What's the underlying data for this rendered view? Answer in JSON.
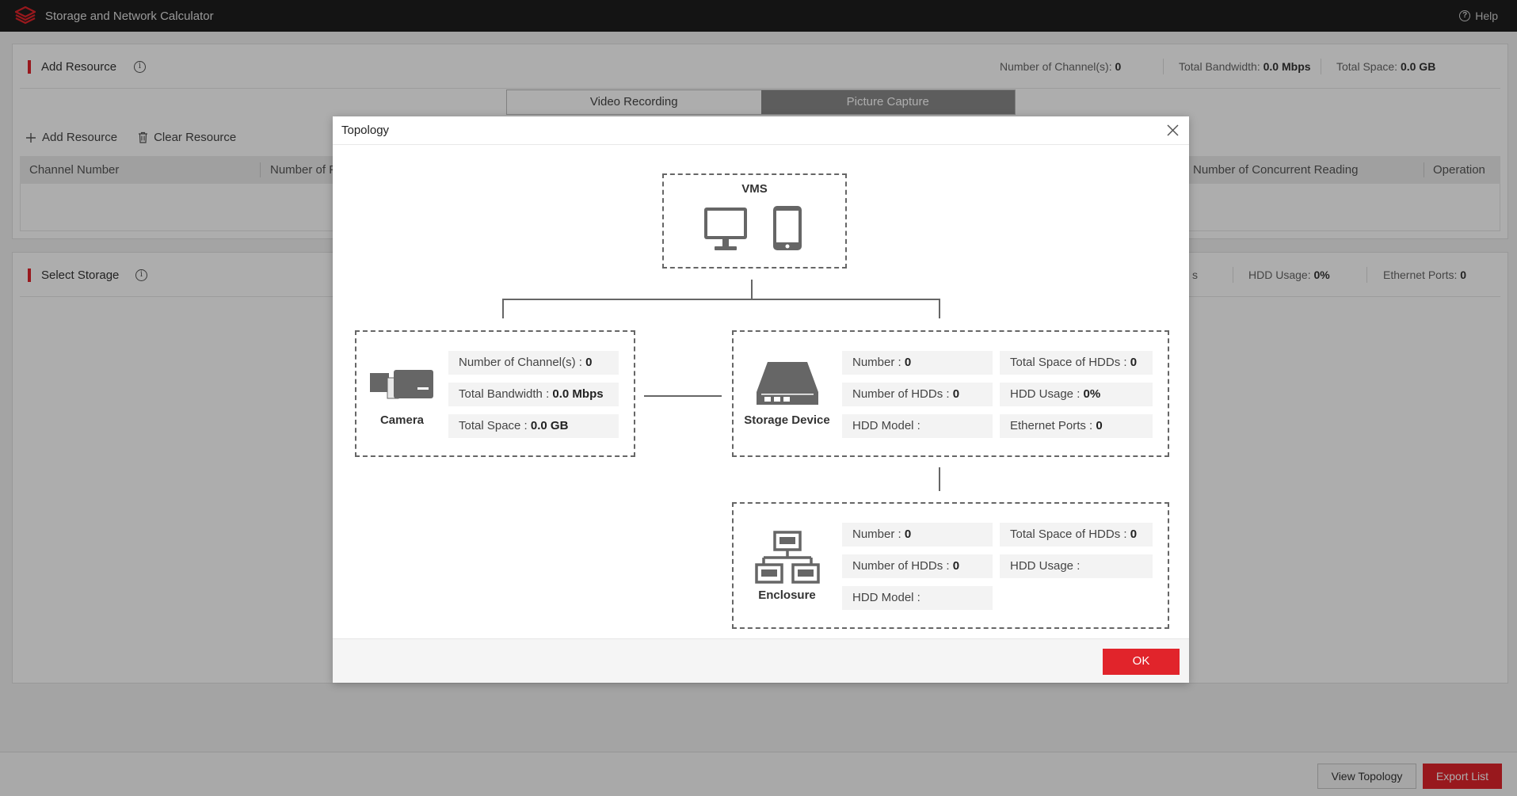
{
  "app": {
    "title": "Storage and Network Calculator",
    "help_label": "Help"
  },
  "add_resource": {
    "title": "Add Resource",
    "stats": {
      "channels_label": "Number of Channel(s):",
      "channels_value": "0",
      "bandwidth_label": "Total Bandwidth:",
      "bandwidth_value": "0.0 Mbps",
      "space_label": "Total Space:",
      "space_value": "0.0 GB"
    },
    "tabs": [
      {
        "label": "Video Recording",
        "active": false
      },
      {
        "label": "Picture Capture",
        "active": true
      }
    ],
    "toolbar": {
      "add_label": "Add Resource",
      "clear_label": "Clear Resource"
    },
    "columns": {
      "col1": "Channel Number",
      "col2": "Number of P",
      "col3": "Number of Concurrent Reading",
      "col4": "Operation"
    }
  },
  "select_storage": {
    "title": "Select Storage",
    "stats": {
      "partial_label": "s",
      "hdd_usage_label": "HDD Usage:",
      "hdd_usage_value": "0%",
      "ethernet_label": "Ethernet Ports:",
      "ethernet_value": "0"
    }
  },
  "footer": {
    "view_topology": "View Topology",
    "export_list": "Export List"
  },
  "modal": {
    "title": "Topology",
    "ok_label": "OK",
    "vms": {
      "label": "VMS"
    },
    "camera": {
      "label": "Camera",
      "channels_label": "Number of Channel(s) : ",
      "channels_value": "0",
      "bandwidth_label": "Total Bandwidth : ",
      "bandwidth_value": "0.0 Mbps",
      "space_label": "Total Space : ",
      "space_value": "0.0 GB"
    },
    "storage": {
      "label": "Storage Device",
      "number_label": "Number : ",
      "number_value": "0",
      "hdds_label": "Number of HDDs : ",
      "hdds_value": "0",
      "model_label": "HDD Model : ",
      "model_value": "",
      "total_space_label": "Total Space of HDDs : ",
      "total_space_value": "0",
      "usage_label": "HDD Usage : ",
      "usage_value": "0%",
      "ethernet_label": "Ethernet Ports : ",
      "ethernet_value": "0"
    },
    "enclosure": {
      "label": "Enclosure",
      "number_label": "Number : ",
      "number_value": "0",
      "hdds_label": "Number of HDDs : ",
      "hdds_value": "0",
      "model_label": "HDD Model : ",
      "model_value": "",
      "total_space_label": "Total Space of HDDs : ",
      "total_space_value": "0",
      "usage_label": "HDD Usage : ",
      "usage_value": ""
    }
  },
  "colors": {
    "accent_red": "#e1242b",
    "titlebar_bg": "#1e1e1e",
    "active_tab": "#8a8a8a"
  }
}
